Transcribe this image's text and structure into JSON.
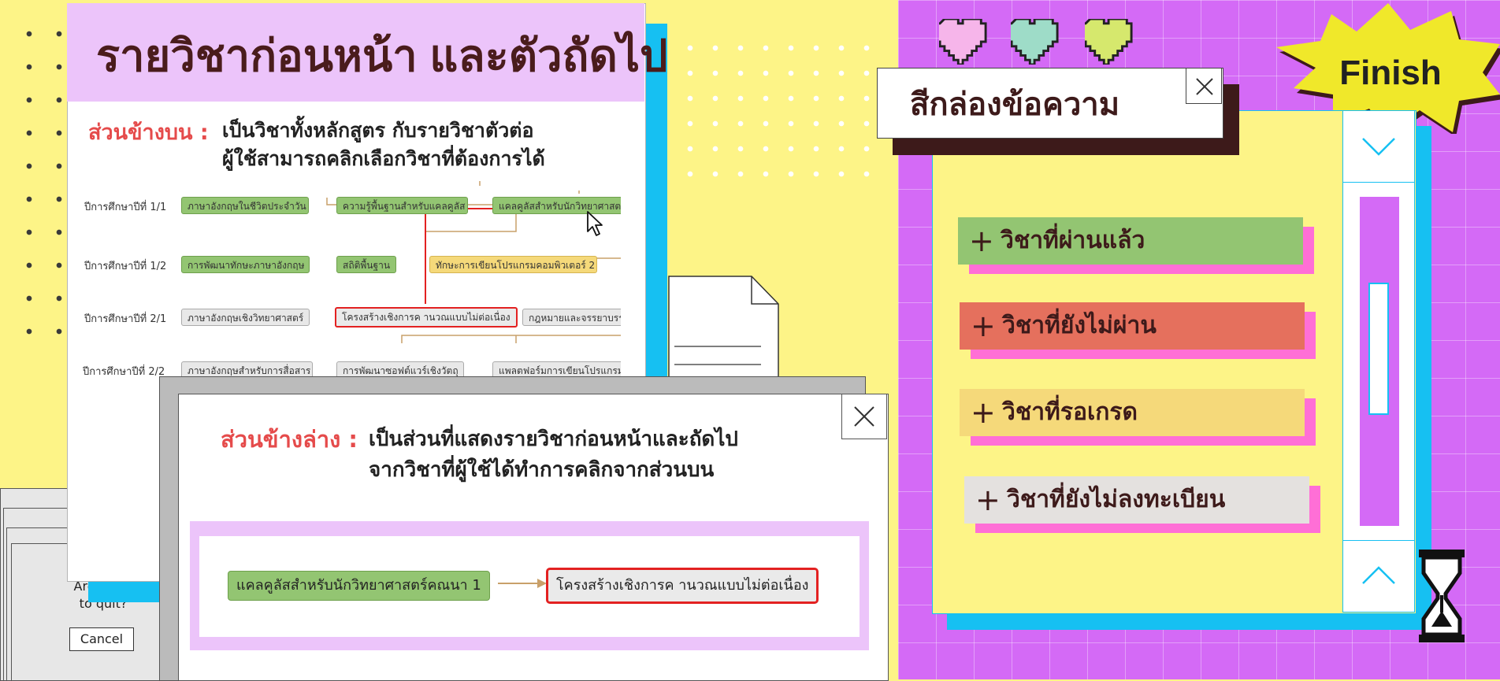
{
  "main_window": {
    "title": "รายวิชาก่อนหน้า และตัวถัดไป",
    "top_section_label": "ส่วนข้างบน :",
    "top_section_desc_line1": "เป็นวิชาทั้งหลักสูตร กับรายวิชาตัวต่อ",
    "top_section_desc_line2": "ผู้ใช้สามารถคลิกเลือกวิชาที่ต้องการได้"
  },
  "curriculum_map": {
    "rows": [
      {
        "label": "ปีการศึกษาปีที่ 1/1",
        "courses": [
          {
            "name": "ภาษาอังกฤษในชีวิตประจำวัน",
            "status": "passed"
          },
          {
            "name": "ความรู้พื้นฐานสำหรับแคลคูลัส",
            "status": "passed"
          },
          {
            "name": "แคลคูลัสสำหรับนักวิทยาศาสตร์",
            "status": "passed"
          }
        ]
      },
      {
        "label": "ปีการศึกษาปีที่ 1/2",
        "courses": [
          {
            "name": "การพัฒนาทักษะภาษาอังกฤษ",
            "status": "passed"
          },
          {
            "name": "สถิติพื้นฐาน",
            "status": "passed"
          },
          {
            "name": "ทักษะการเขียนโปรแกรมคอมพิวเตอร์ 2",
            "status": "waiting"
          }
        ]
      },
      {
        "label": "ปีการศึกษาปีที่ 2/1",
        "courses": [
          {
            "name": "ภาษาอังกฤษเชิงวิทยาศาสตร์",
            "status": "not_registered"
          },
          {
            "name": "โครงสร้างเชิงการค านวณแบบไม่ต่อเนื่อง",
            "status": "selected"
          },
          {
            "name": "กฎหมายและจรรยาบรรณ",
            "status": "not_registered"
          }
        ]
      },
      {
        "label": "ปีการศึกษาปีที่ 2/2",
        "courses": [
          {
            "name": "ภาษาอังกฤษสำหรับการสื่อสาร",
            "status": "not_registered"
          },
          {
            "name": "การพัฒนาซอฟต์แวร์เชิงวัตถุ",
            "status": "not_registered"
          },
          {
            "name": "แพลตฟอร์มการเขียนโปรแกรม",
            "status": "not_registered"
          }
        ]
      }
    ]
  },
  "quit_dialog": {
    "message_line1": "Are you s",
    "message_line2": "to quit?",
    "cancel_label": "Cancel"
  },
  "bottom_window": {
    "section_label": "ส่วนข้างล่าง :",
    "desc_line1": "เป็นส่วนที่แสดงรายวิชาก่อนหน้าและถัดไป",
    "desc_line2": "จากวิชาที่ผู้ใช้ได้ทำการคลิกจากส่วนบน",
    "prerequisite_course": "แคลคูลัสสำหรับนักวิทยาศาสตร์คณนา 1",
    "next_course": "โครงสร้างเชิงการค านวณแบบไม่ต่อเนื่อง"
  },
  "legend_window": {
    "title": "สีกล่องข้อความ",
    "items": [
      {
        "label": "วิชาที่ผ่านแล้ว",
        "color": "#93c572"
      },
      {
        "label": "วิชาที่ยังไม่ผ่าน",
        "color": "#e5705d"
      },
      {
        "label": "วิชาที่รอเกรด",
        "color": "#f5d97a"
      },
      {
        "label": "วิชาที่ยังไม่ลงทะเบียน",
        "color": "#e4e1df"
      }
    ]
  },
  "finish_badge": {
    "label": "Finish"
  },
  "colors": {
    "left_background": "#fdf487",
    "right_background": "#d46af6",
    "accent_cyan": "#16c0f2",
    "highlight_red": "#e32121",
    "label_red": "#e54b4b",
    "header_lavender": "#ecc4fa",
    "shadow_pink": "#ff6fd6",
    "hearts": [
      "#f6b5ea",
      "#9edcc8",
      "#d6e86d"
    ]
  }
}
